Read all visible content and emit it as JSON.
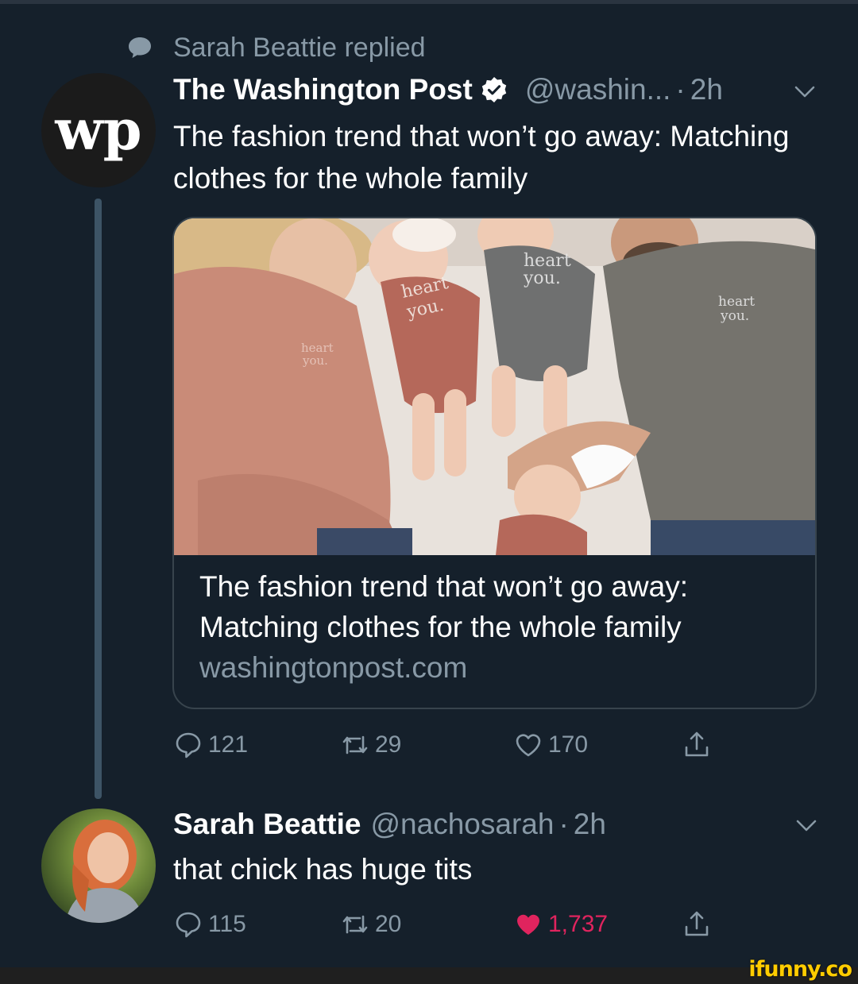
{
  "context": {
    "text": "Sarah Beattie replied",
    "icon": "speech-bubble-icon"
  },
  "tweet1": {
    "author_name": "The Washington Post",
    "author_handle": "@washin...",
    "time": "2h",
    "text": "The fashion trend that won’t go away: Matching clothes for the whole family",
    "avatar_logo": "wp",
    "card": {
      "title": "The fashion trend that won’t go away: Matching clothes for the whole family",
      "domain": "washingtonpost.com",
      "photo_shirt_text": [
        "heart",
        "you."
      ]
    },
    "replies": "121",
    "retweets": "29",
    "likes": "170"
  },
  "tweet2": {
    "author_name": "Sarah Beattie",
    "author_handle": "@nachosarah",
    "time": "2h",
    "text": "that chick has huge tits",
    "replies": "115",
    "retweets": "20",
    "likes": "1,737",
    "liked": true
  },
  "watermark": "ifunny.co",
  "colors": {
    "background": "#15202b",
    "secondary_text": "#8899a6",
    "like_red": "#e0245e",
    "verified_bg": "#ffffff"
  }
}
